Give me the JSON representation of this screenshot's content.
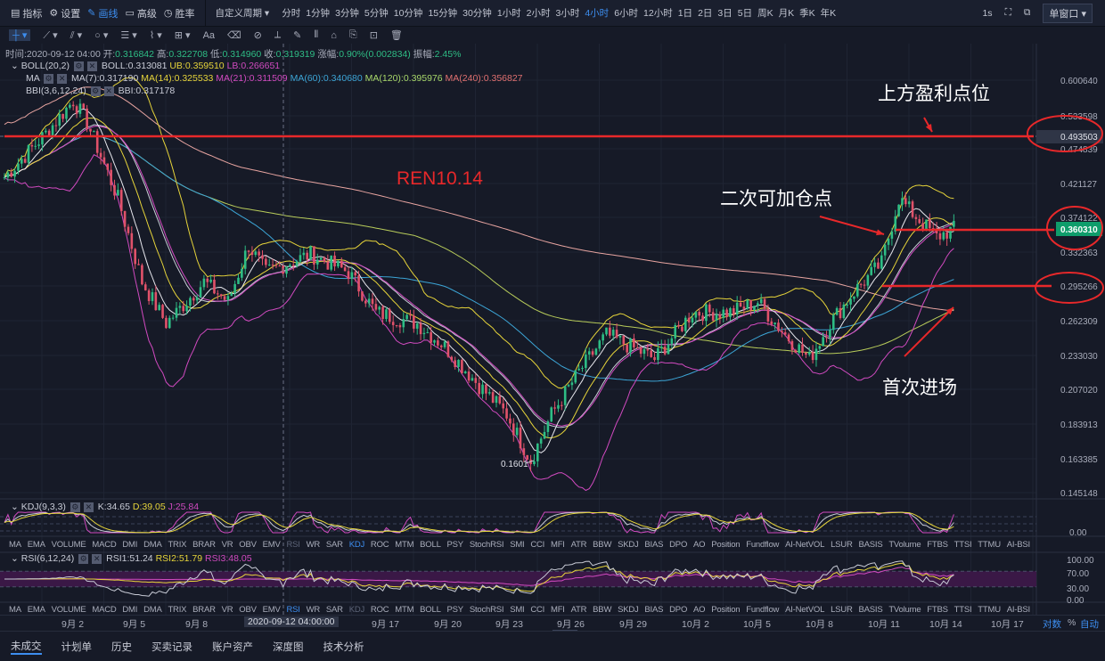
{
  "toolbar": {
    "items": [
      "指标",
      "设置",
      "画线",
      "高级",
      "胜率"
    ],
    "period_dropdown": "自定义周期",
    "periods": [
      "分时",
      "1分钟",
      "3分钟",
      "5分钟",
      "10分钟",
      "15分钟",
      "30分钟",
      "1小时",
      "2小时",
      "3小时",
      "4小时",
      "6小时",
      "12小时",
      "1日",
      "2日",
      "3日",
      "5日",
      "周K",
      "月K",
      "季K",
      "年K"
    ],
    "active_period": "4小时",
    "refresh": "1s",
    "window_mode": "单窗口"
  },
  "drawing_tools": [
    "crosshair-icon",
    "trendline-icon",
    "parallel-lines-icon",
    "circle-icon",
    "horizontal-lines-icon",
    "wave-icon",
    "grid-icon",
    "text-icon",
    "eraser-icon",
    "magnet-icon",
    "ruler-icon",
    "pen-icon",
    "measure-icon",
    "lock-icon",
    "copy-icon",
    "screenshot-icon",
    "trash-icon"
  ],
  "drawing_text_tool": "Aa",
  "ohlc": {
    "time": "时间:2020-09-12 04:00",
    "open_l": "开:",
    "open": "0.316842",
    "high_l": "高:",
    "high": "0.322708",
    "low_l": "低:",
    "low": "0.314960",
    "close_l": "收:",
    "close": "0.319319",
    "chg_l": "涨幅:",
    "chg": "0.90%(0.002834)",
    "amp_l": "振幅:",
    "amp": "2.45%"
  },
  "indicators": {
    "boll": {
      "name": "BOLL(20,2)",
      "boll": "BOLL:0.313081",
      "ub": "UB:0.359510",
      "lb": "LB:0.266651"
    },
    "ma": {
      "name": "MA",
      "ma7": "MA(7):0.317190",
      "ma14": "MA(14):0.325533",
      "ma21": "MA(21):0.311509",
      "ma60": "MA(60):0.340680",
      "ma120": "MA(120):0.395976",
      "ma240": "MA(240):0.356827"
    },
    "bbi": {
      "name": "BBI(3,6,12,24)",
      "bbi": "BBI:0.317178"
    },
    "kdj": {
      "name": "KDJ(9,3,3)",
      "k": "K:34.65",
      "d": "D:39.05",
      "j": "J:25.84"
    },
    "rsi": {
      "name": "RSI(6,12,24)",
      "r1": "RSI1:51.24",
      "r2": "RSI2:51.79",
      "r3": "RSI3:48.05"
    }
  },
  "price_axis": [
    "0.600640",
    "0.533598",
    "0.474839",
    "0.421127",
    "0.374122",
    "0.332363",
    "0.295266",
    "0.262309",
    "0.233030",
    "0.207020",
    "0.183913",
    "0.163385",
    "0.145148"
  ],
  "crosshair_price": "0.493503",
  "last_price": "0.360310",
  "min_label": "0.1601",
  "kdj_axis": [
    "0.00"
  ],
  "rsi_axis": [
    "100.00",
    "70.00",
    "30.00",
    "0.00"
  ],
  "indicator_tabs": [
    "MA",
    "EMA",
    "VOLUME",
    "MACD",
    "DMI",
    "DMA",
    "TRIX",
    "BRAR",
    "VR",
    "OBV",
    "EMV",
    "RSI",
    "WR",
    "SAR",
    "KDJ",
    "ROC",
    "MTM",
    "BOLL",
    "PSY",
    "StochRSI",
    "SMI",
    "CCI",
    "MFI",
    "ATR",
    "BBW",
    "SKDJ",
    "BIAS",
    "DPO",
    "AO",
    "Position",
    "Fundflow",
    "AI-NetVOL",
    "LSUR",
    "BASIS",
    "TVolume",
    "FTBS",
    "TTSI",
    "TTMU",
    "AI-BSI"
  ],
  "dates": [
    "9月 2",
    "9月 5",
    "9月 8",
    "14",
    "9月 17",
    "9月 20",
    "9月 23",
    "9月 26",
    "9月 29",
    "10月 2",
    "10月 5",
    "10月 8",
    "10月 11",
    "10月 14",
    "10月 17"
  ],
  "crosshair_date": "2020-09-12 04:00:00",
  "axis_modes": [
    "对数",
    "%",
    "自动"
  ],
  "bottom_tabs": [
    "未成交",
    "计划单",
    "历史",
    "买卖记录",
    "账户资产",
    "深度图",
    "技术分析"
  ],
  "annotations": {
    "title": "REN10.14",
    "take_profit": "上方盈利点位",
    "add_position": "二次可加仓点",
    "first_entry": "首次进场"
  },
  "colors": {
    "up": "#2ebd85",
    "down": "#e0526a",
    "annotation": "#e8282a",
    "accent": "#3d8ef0"
  },
  "chart_data": {
    "type": "candlestick",
    "interval": "4h",
    "scale": "log",
    "ylim": [
      0.145148,
      0.60064
    ],
    "keypoints_index_price": [
      [
        0,
        0.43
      ],
      [
        12,
        0.5
      ],
      [
        20,
        0.56
      ],
      [
        24,
        0.52
      ],
      [
        33,
        0.4
      ],
      [
        40,
        0.3
      ],
      [
        47,
        0.26
      ],
      [
        50,
        0.27
      ],
      [
        58,
        0.3
      ],
      [
        65,
        0.28
      ],
      [
        71,
        0.34
      ],
      [
        76,
        0.31
      ],
      [
        89,
        0.33
      ],
      [
        100,
        0.31
      ],
      [
        108,
        0.27
      ],
      [
        120,
        0.26
      ],
      [
        128,
        0.24
      ],
      [
        138,
        0.21
      ],
      [
        146,
        0.19
      ],
      [
        153,
        0.162
      ],
      [
        159,
        0.19
      ],
      [
        167,
        0.22
      ],
      [
        175,
        0.25
      ],
      [
        182,
        0.24
      ],
      [
        189,
        0.23
      ],
      [
        200,
        0.27
      ],
      [
        211,
        0.27
      ],
      [
        219,
        0.28
      ],
      [
        227,
        0.25
      ],
      [
        234,
        0.23
      ],
      [
        240,
        0.26
      ],
      [
        247,
        0.29
      ],
      [
        255,
        0.32
      ],
      [
        260,
        0.4
      ],
      [
        264,
        0.38
      ],
      [
        271,
        0.35
      ],
      [
        276,
        0.36
      ]
    ],
    "candle_count": 277
  }
}
